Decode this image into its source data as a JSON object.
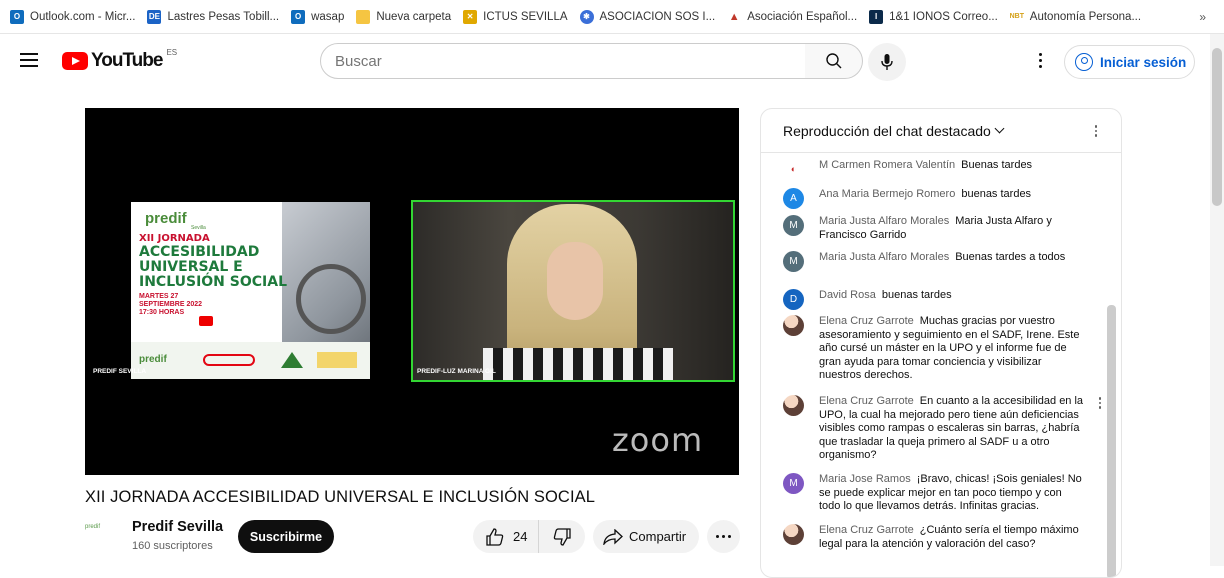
{
  "bookmarks": [
    {
      "label": "Outlook.com - Micr...",
      "icon": "outlook-icon",
      "color": "#0f6cbd"
    },
    {
      "label": "Lastres Pesas Tobill...",
      "icon": "de-icon",
      "color": "#1b63c6"
    },
    {
      "label": "wasap",
      "icon": "outlook-icon",
      "color": "#0f6cbd"
    },
    {
      "label": "Nueva carpeta",
      "icon": "folder-icon",
      "color": "#f5c542"
    },
    {
      "label": "ICTUS SEVILLA",
      "icon": "ictus-icon",
      "color": "#e0a800"
    },
    {
      "label": "ASOCIACION SOS I...",
      "icon": "sos-icon",
      "color": "#3b6fd8"
    },
    {
      "label": "Asociación Español...",
      "icon": "mountain-icon",
      "color": "#c0392b"
    },
    {
      "label": "1&1 IONOS Correo...",
      "icon": "ionos-icon",
      "color": "#0b2a4a"
    },
    {
      "label": "Autonomía Persona...",
      "icon": "nbt-icon",
      "color": "#d4a017"
    }
  ],
  "bookmarks_more": "»",
  "masthead": {
    "logo_text": "YouTube",
    "country_code": "ES",
    "search_placeholder": "Buscar",
    "signin_label": "Iniciar sesión"
  },
  "player": {
    "poster_brand": "predif",
    "poster_brand_sub": "Sevilla",
    "poster_title_line1": "XII JORNADA",
    "poster_title_line2": "ACCESIBILIDAD",
    "poster_title_line3": "UNIVERSAL E",
    "poster_title_line4": "INCLUSIÓN SOCIAL",
    "poster_date_line1": "MARTES 27",
    "poster_date_line2": "SEPTIEMBRE 2022",
    "poster_date_line3": "17:30 HORAS",
    "left_tile_label": "PREDIF SEVILLA",
    "right_tile_label": "PREDIF-LUZ MARINA GIL",
    "watermark": "zoom"
  },
  "video": {
    "title": "XII JORNADA ACCESIBILIDAD UNIVERSAL E INCLUSIÓN SOCIAL",
    "channel_name": "Predif Sevilla",
    "subscribers": "160 suscriptores",
    "subscribe_label": "Suscribirme",
    "likes": "24",
    "share_label": "Compartir"
  },
  "chat": {
    "header": "Reproducción del chat destacado",
    "messages": [
      {
        "author": "M Carmen Romera Valentín",
        "text": "Buenas tardes",
        "avatar": "",
        "avatar_color": "#ffffff"
      },
      {
        "author": "Ana Maria Bermejo Romero",
        "text": "buenas tardes",
        "avatar": "A",
        "avatar_color": "#1e88e5"
      },
      {
        "author": "Maria Justa Alfaro Morales",
        "text": "Maria Justa Alfaro y Francisco Garrido",
        "avatar": "M",
        "avatar_color": "#546e7a"
      },
      {
        "author": "Maria Justa Alfaro Morales",
        "text": "Buenas tardes a todos",
        "avatar": "M",
        "avatar_color": "#546e7a"
      },
      {
        "author": "David Rosa",
        "text": "buenas tardes",
        "avatar": "D",
        "avatar_color": "#1565c0"
      },
      {
        "author": "Elena Cruz Garrote",
        "text": "Muchas gracias por vuestro asesoramiento y seguimiento en el SADF, Irene. Este año cursé un máster en la UPO y el informe fue de gran ayuda para tomar conciencia y visibilizar nuestros derechos.",
        "avatar": "",
        "avatar_color": "#6d4c41"
      },
      {
        "author": "Elena Cruz Garrote",
        "text": "En cuanto a la accesibilidad en la UPO, la cual ha mejorado pero tiene aún deficiencias visibles como rampas o escaleras sin barras, ¿habría que trasladar la queja primero al SADF u a otro organismo?",
        "avatar": "",
        "avatar_color": "#6d4c41"
      },
      {
        "author": "Maria Jose Ramos",
        "text": "¡Bravo, chicas! ¡Sois geniales! No se puede explicar mejor en tan poco tiempo y con todo lo que llevamos detrás. Infinitas gracias.",
        "avatar": "M",
        "avatar_color": "#7e57c2"
      },
      {
        "author": "Elena Cruz Garrote",
        "text": "¿Cuánto sería el tiempo máximo legal para la atención y valoración del caso?",
        "avatar": "",
        "avatar_color": "#6d4c41"
      }
    ]
  }
}
